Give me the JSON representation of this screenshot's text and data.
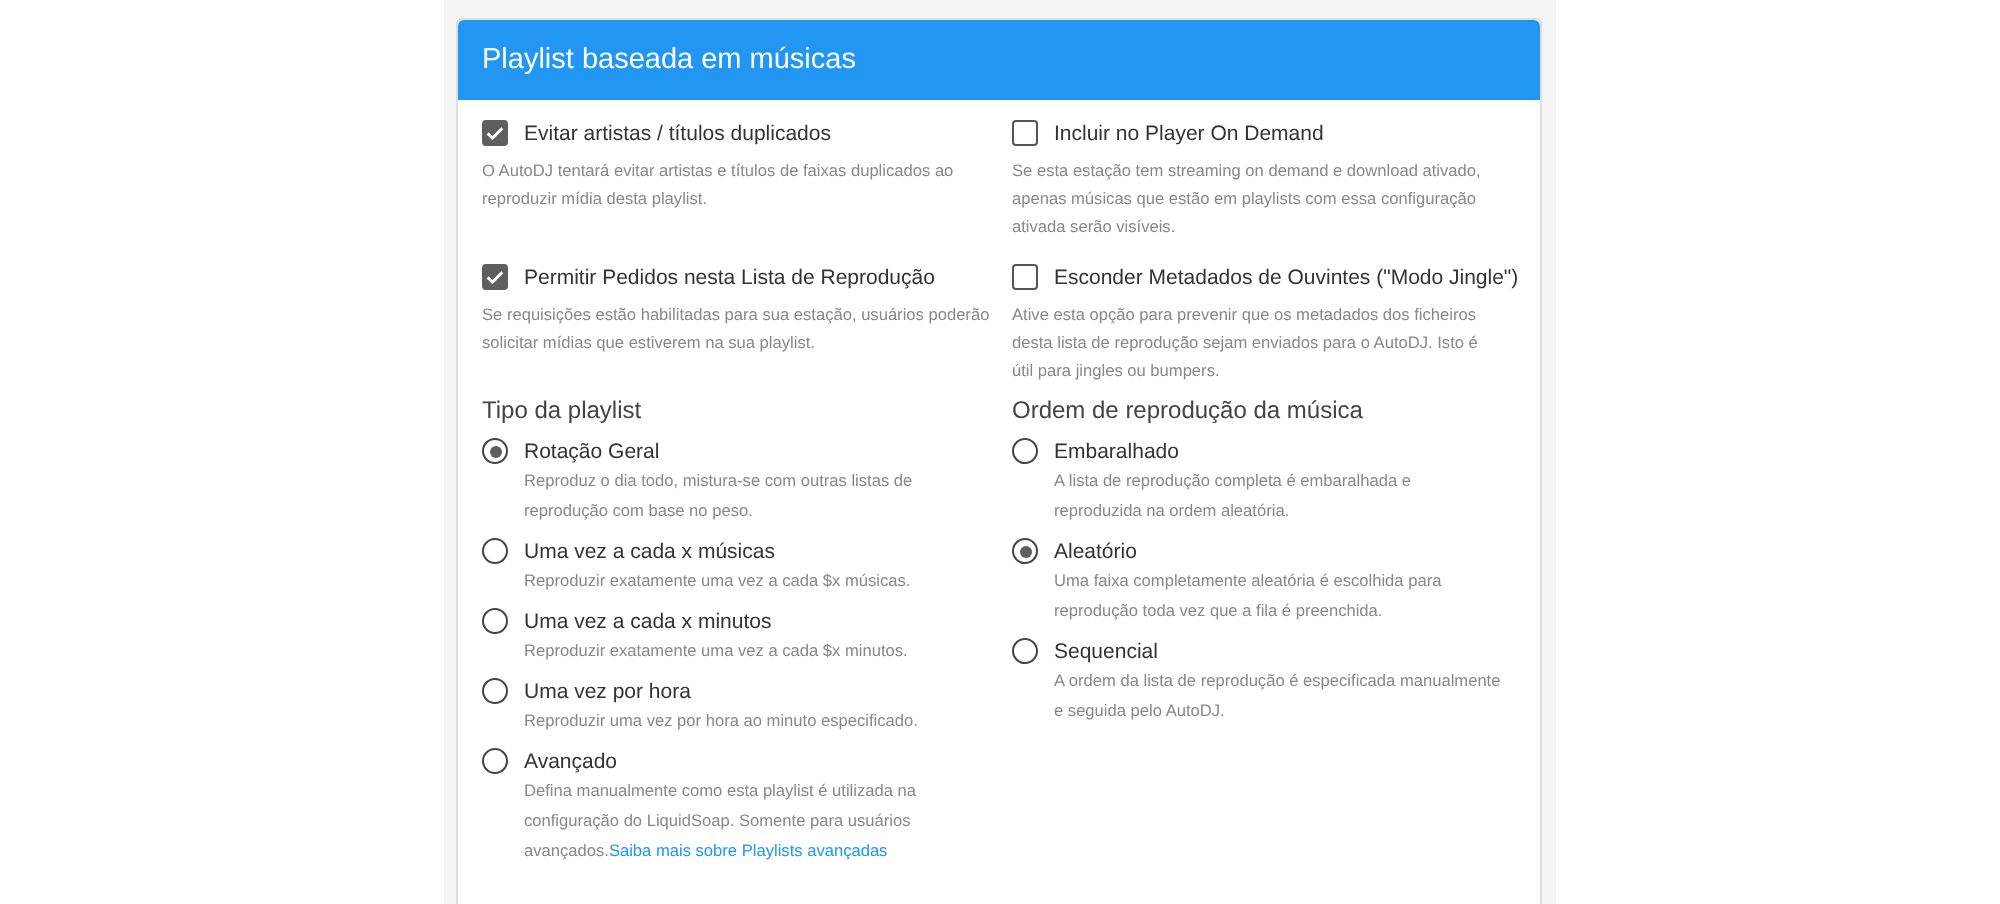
{
  "card": {
    "title": "Playlist baseada em músicas"
  },
  "checkboxes": [
    {
      "label": "Evitar artistas / títulos duplicados",
      "checked": true,
      "description": "O AutoDJ tentará evitar artistas e títulos de faixas duplicados ao reproduzir mídia desta playlist."
    },
    {
      "label": "Incluir no Player On Demand",
      "checked": false,
      "description": "Se esta estação tem streaming on demand e download ativado, apenas músicas que estão em playlists com essa configuração ativada serão visíveis."
    },
    {
      "label": "Permitir Pedidos nesta Lista de Reprodução",
      "checked": true,
      "description": "Se requisições estão habilitadas para sua estação, usuários poderão solicitar mídias que estiverem na sua playlist."
    },
    {
      "label": "Esconder Metadados de Ouvintes (\"Modo Jingle\")",
      "checked": false,
      "description": "Ative esta opção para prevenir que os metadados dos ficheiros desta lista de reprodução sejam enviados para o AutoDJ. Isto é útil para jingles ou bumpers."
    }
  ],
  "radio_groups": [
    {
      "title": "Tipo da playlist",
      "options": [
        {
          "label": "Rotação Geral",
          "selected": true,
          "description": "Reproduz o dia todo, mistura-se com outras listas de reprodução com base no peso."
        },
        {
          "label": "Uma vez a cada x músicas",
          "selected": false,
          "description": "Reproduzir exatamente uma vez a cada $x músicas."
        },
        {
          "label": "Uma vez a cada x minutos",
          "selected": false,
          "description": "Reproduzir exatamente uma vez a cada $x minutos."
        },
        {
          "label": "Uma vez por hora",
          "selected": false,
          "description": "Reproduzir uma vez por hora ao minuto especificado."
        },
        {
          "label": "Avançado",
          "selected": false,
          "description": "Defina manualmente como esta playlist é utilizada na configuração do LiquidSoap. Somente para usuários avançados.",
          "link": "Saiba mais sobre Playlists avançadas"
        }
      ]
    },
    {
      "title": "Ordem de reprodução da música",
      "options": [
        {
          "label": "Embaralhado",
          "selected": false,
          "description": "A lista de reprodução completa é embaralhada e reproduzida na ordem aleatória."
        },
        {
          "label": "Aleatório",
          "selected": true,
          "description": "Uma faixa completamente aleatória é escolhida para reprodução toda vez que a fila é preenchida."
        },
        {
          "label": "Sequencial",
          "selected": false,
          "description": "A ordem da lista de reprodução é especificada manualmente e seguida pelo AutoDJ."
        }
      ]
    }
  ]
}
